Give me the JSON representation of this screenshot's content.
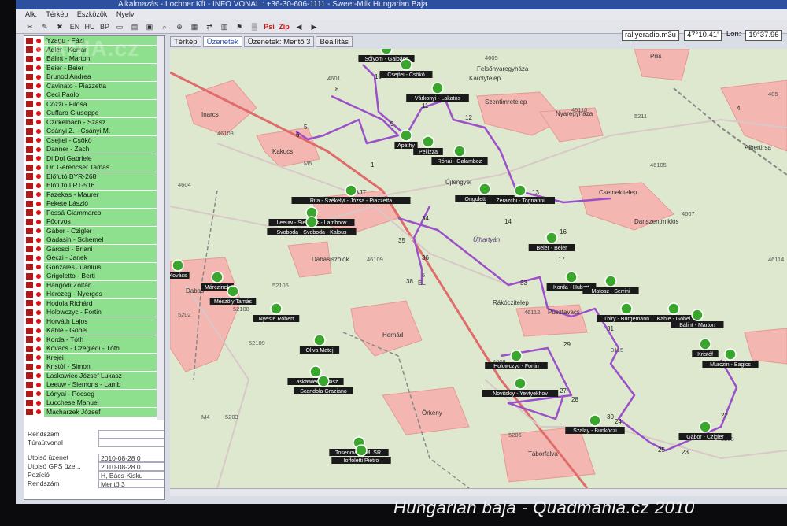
{
  "window": {
    "title": "Alkalmazás - Lochner Kft - INFO VONAL : +36-30-606-1111 - Sweet-Milk Hungarian Baja"
  },
  "menu": [
    "Alk.",
    "Térkép",
    "Eszközök",
    "Nyelv"
  ],
  "toolbar": {
    "b1": "EN",
    "b2": "HU",
    "b3": "BP",
    "b4": "Psi",
    "b5": "Zip"
  },
  "tabs": [
    "Térkép",
    "Üzenetek",
    "Üzenetek: Mentő 3",
    "Beállítás"
  ],
  "coords": {
    "file": "rallyeradio.m3u",
    "lat": "47°10.41'",
    "lon_label": "Lon:",
    "lon": "19°37.96"
  },
  "competitors": [
    "Yzagu - Fázi",
    "Adler - Korrar",
    "Bálint - Marton",
    "Beier - Beier",
    "Brunod Andrea",
    "Cavinato - Piazzetta",
    "Ceci Paolo",
    "Cozzi - Filosa",
    "Cuffaro Giuseppe",
    "Czirkelbach - Szász",
    "Csányi Z. - Csányi M.",
    "Csejtei - Csökö",
    "Danner - Zach",
    "Di Doi Gabriele",
    "Dr. Gerencsér Tamás",
    "Előfutó BYR-268",
    "Előfutó LRT-516",
    "Fazekas - Maurer",
    "Fekete László",
    "Fossá Giammarco",
    "Főorvos",
    "Gábor - Czigler",
    "Gadasin - Schemel",
    "Garosci - Briani",
    "Géczi - Janek",
    "Gonzales Juanluis",
    "Grigoletto - Berti",
    "Hangodi Zoltán",
    "Herczeg - Nyerges",
    "Hodola Richárd",
    "Holowczyc - Fortin",
    "Horváth Lajos",
    "Kahle - Göbel",
    "Korda - Tóth",
    "Kovács - Czeglédi - Tóth",
    "Krejei",
    "Kristóf - Simon",
    "Laskawiec József Lukasz",
    "Leeuw - Siemons - Lamb",
    "Lónyai - Pocseg",
    "Lucchese Manuel",
    "Macharzek József"
  ],
  "info_panel": {
    "rendszam_label": "Rendszám",
    "rendszam_value": "",
    "turautvonal_label": "Túraútvonal",
    "turautvonal_value": "",
    "rows": [
      {
        "label": "Utolsó üzenet",
        "value": "2010-08-28 0"
      },
      {
        "label": "Utolsó GPS üze...",
        "value": "2010-08-28 0"
      },
      {
        "label": "Pozíció",
        "value": "H, Bács-Kisku"
      },
      {
        "label": "Rendszám",
        "value": "Mentő 3"
      }
    ]
  },
  "map": {
    "places": [
      "Felsőnyaregyháza",
      "Karolytelep",
      "Szentimretelep",
      "Nyaregyháza",
      "Inarcs",
      "Kakucs",
      "Újlengyel",
      "Csetnekitelep",
      "Danszentmiklós",
      "Dabasiszőlők",
      "Rákóczitelep",
      "Pusztavacs",
      "Hernád",
      "Örkény",
      "Táborfalva",
      "Pilis",
      "Albertirsa",
      "Újhartyán",
      "AJT",
      "ÉL",
      "Dabas"
    ],
    "roads": [
      "4601",
      "4605",
      "4606",
      "4604",
      "46108",
      "46109",
      "46110",
      "46112",
      "46114",
      "4607",
      "4608",
      "52106",
      "52108",
      "52109",
      "5202",
      "5203",
      "5206",
      "5208",
      "5211",
      "M5",
      "M4",
      "3115",
      "405",
      "5",
      "46105"
    ],
    "waypoints": [
      "1",
      "5",
      "6",
      "8",
      "9",
      "10",
      "11",
      "12",
      "13",
      "14",
      "16",
      "17",
      "22",
      "23",
      "24",
      "25",
      "27",
      "28",
      "29",
      "30",
      "31",
      "33",
      "34",
      "35",
      "36",
      "38",
      "4"
    ],
    "vehicles": [
      "Sólyom - Galbács",
      "Csejtei - Csökö",
      "Várkonyi - Lakatos",
      "Apáthy",
      "Pellizza",
      "Rónai - Galamboz",
      "Ongoletto - Berti",
      "Zerazchi - Tognarini",
      "Rita - Székelyi - Józsa - Piazzetta",
      "Leeuw - Siemons - Lamboov",
      "Svoboda - Svoboda - Kalous",
      "Beier - Beier",
      "Korda - Hubert",
      "Matosz - Serrini",
      "Thiry - Burgemann",
      "Kahle - Göbel",
      "Bálint - Marton",
      "Kristóf",
      "Murczin - Bagics",
      "Kovács",
      "Márczinek",
      "Mészöly Tamás",
      "Nyeste Róbert",
      "Oliva Matej",
      "Laskawiec Lukasz",
      "Scandola Graziano",
      "Holowczyc - Fortin",
      "Novitskiy - Yevtyekhov",
      "Szalay - Bunkóczi",
      "Gábor - Czigler",
      "Tosenovsky M. SR.",
      "Ioffoletti Pietro"
    ]
  },
  "caption": "Hungarian baja - Quadmania.cz 2010",
  "watermark": "MANIA.cz"
}
